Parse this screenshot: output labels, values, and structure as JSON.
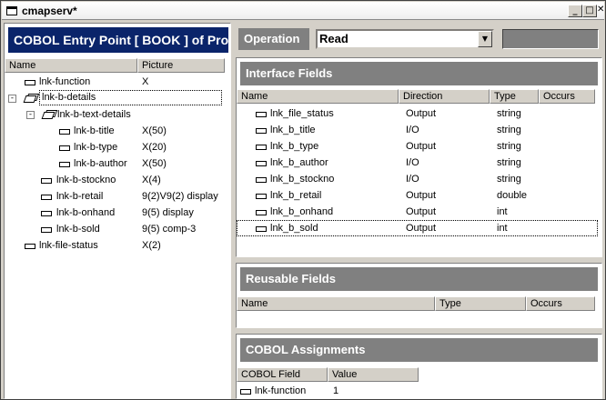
{
  "window": {
    "title": "cmapserv*"
  },
  "left": {
    "header": "COBOL Entry Point [ BOOK ] of Prog",
    "columns": {
      "name": "Name",
      "picture": "Picture"
    },
    "tree": [
      {
        "label": "lnk-function",
        "picture": "X"
      },
      {
        "label": "lnk-b-details",
        "picture": ""
      },
      {
        "label": "lnk-b-text-details",
        "picture": ""
      },
      {
        "label": "lnk-b-title",
        "picture": "X(50)"
      },
      {
        "label": "lnk-b-type",
        "picture": "X(20)"
      },
      {
        "label": "lnk-b-author",
        "picture": "X(50)"
      },
      {
        "label": "lnk-b-stockno",
        "picture": "X(4)"
      },
      {
        "label": "lnk-b-retail",
        "picture": "9(2)V9(2) display"
      },
      {
        "label": "lnk-b-onhand",
        "picture": "9(5) display"
      },
      {
        "label": "lnk-b-sold",
        "picture": "9(5) comp-3"
      },
      {
        "label": "lnk-file-status",
        "picture": "X(2)"
      }
    ]
  },
  "operation": {
    "label": "Operation",
    "value": "Read"
  },
  "interface": {
    "title": "Interface Fields",
    "columns": {
      "name": "Name",
      "direction": "Direction",
      "type": "Type",
      "occurs": "Occurs"
    },
    "rows": [
      {
        "name": "lnk_file_status",
        "direction": "Output",
        "type": "string"
      },
      {
        "name": "lnk_b_title",
        "direction": "I/O",
        "type": "string"
      },
      {
        "name": "lnk_b_type",
        "direction": "Output",
        "type": "string"
      },
      {
        "name": "lnk_b_author",
        "direction": "I/O",
        "type": "string"
      },
      {
        "name": "lnk_b_stockno",
        "direction": "I/O",
        "type": "string"
      },
      {
        "name": "lnk_b_retail",
        "direction": "Output",
        "type": "double"
      },
      {
        "name": "lnk_b_onhand",
        "direction": "Output",
        "type": "int"
      },
      {
        "name": "lnk_b_sold",
        "direction": "Output",
        "type": "int"
      }
    ]
  },
  "reusable": {
    "title": "Reusable Fields",
    "columns": {
      "name": "Name",
      "type": "Type",
      "occurs": "Occurs"
    }
  },
  "assignments": {
    "title": "COBOL Assignments",
    "columns": {
      "field": "COBOL Field",
      "value": "Value"
    },
    "rows": [
      {
        "field": "lnk-function",
        "value": "1"
      }
    ]
  }
}
